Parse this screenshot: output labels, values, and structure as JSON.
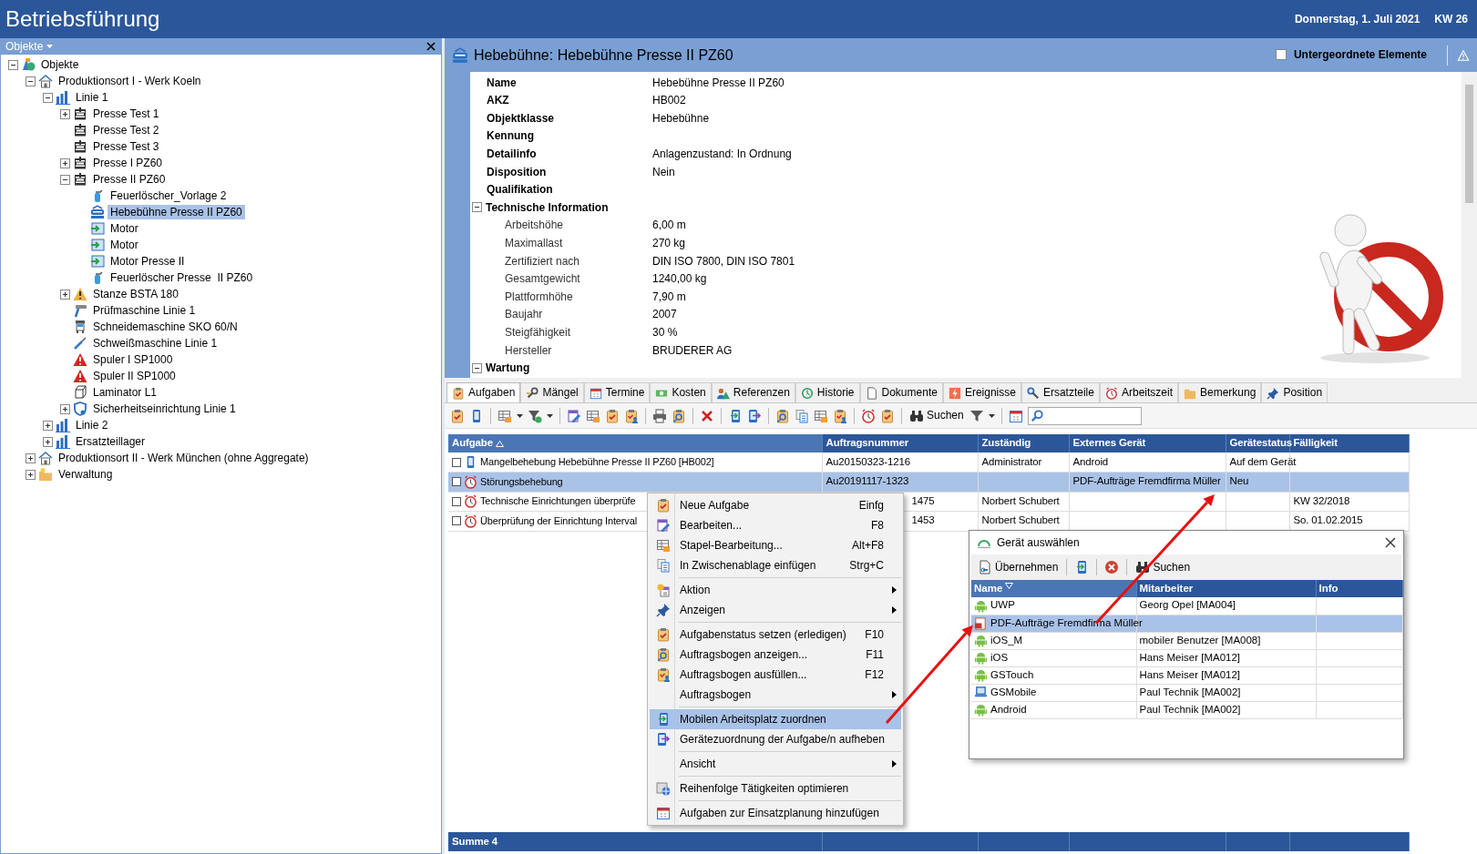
{
  "app": {
    "title": "Betriebsführung",
    "date": "Donnerstag, 1. Juli 2021",
    "week": "KW 26"
  },
  "objects_panel": {
    "title": "Objekte",
    "tree": [
      {
        "label": "Objekte",
        "kind": "root",
        "expanded": true,
        "selected": false,
        "children": [
          {
            "label": "Produktionsort I - Werk Koeln",
            "kind": "site",
            "expanded": true,
            "selected": false,
            "children": [
              {
                "label": "Linie 1",
                "kind": "line",
                "expanded": true,
                "selected": false,
                "children": [
                  {
                    "label": "Presse Test 1",
                    "kind": "press",
                    "expanded": false,
                    "selected": false
                  },
                  {
                    "label": "Presse Test 2",
                    "kind": "press",
                    "selected": false
                  },
                  {
                    "label": "Presse Test 3",
                    "kind": "press",
                    "selected": false
                  },
                  {
                    "label": "Presse I PZ60",
                    "kind": "press",
                    "expanded": false,
                    "selected": false
                  },
                  {
                    "label": "Presse II PZ60",
                    "kind": "press",
                    "expanded": true,
                    "selected": false,
                    "children": [
                      {
                        "label": "Feuerlöscher_Vorlage 2",
                        "kind": "extinguisher",
                        "selected": false
                      },
                      {
                        "label": "Hebebühne Presse II PZ60",
                        "kind": "lift",
                        "selected": true
                      },
                      {
                        "label": "Motor",
                        "kind": "motor",
                        "selected": false
                      },
                      {
                        "label": "Motor",
                        "kind": "motor",
                        "selected": false
                      },
                      {
                        "label": "Motor Presse II",
                        "kind": "motor",
                        "selected": false
                      },
                      {
                        "label": "Feuerlöscher Presse  II PZ60",
                        "kind": "extinguisher",
                        "selected": false
                      }
                    ]
                  },
                  {
                    "label": "Stanze BSTA 180",
                    "kind": "warning",
                    "expanded": false,
                    "selected": false
                  },
                  {
                    "label": "Prüfmaschine Linie 1",
                    "kind": "tester",
                    "selected": false
                  },
                  {
                    "label": "Schneidemaschine SKO 60/N",
                    "kind": "cutter",
                    "selected": false
                  },
                  {
                    "label": "Schweißmaschine Linie 1",
                    "kind": "welder",
                    "selected": false
                  },
                  {
                    "label": "Spuler I SP1000",
                    "kind": "alert",
                    "selected": false
                  },
                  {
                    "label": "Spuler II SP1000",
                    "kind": "alert",
                    "selected": false
                  },
                  {
                    "label": "Laminator L1",
                    "kind": "laminator",
                    "selected": false
                  },
                  {
                    "label": "Sicherheitseinrichtung Linie 1",
                    "kind": "shield",
                    "expanded": false,
                    "selected": false
                  }
                ]
              },
              {
                "label": "Linie 2",
                "kind": "line",
                "expanded": false,
                "selected": false
              },
              {
                "label": "Ersatzteillager",
                "kind": "line",
                "expanded": false,
                "selected": false
              }
            ]
          },
          {
            "label": "Produktionsort II - Werk München (ohne Aggregate)",
            "kind": "site",
            "expanded": false,
            "selected": false
          },
          {
            "label": "Verwaltung",
            "kind": "folder",
            "expanded": false,
            "selected": false
          }
        ]
      }
    ]
  },
  "detail": {
    "title": "Hebebühne: Hebebühne Presse II PZ60",
    "subordinate": {
      "label": "Untergeordnete Elemente",
      "checked": false
    },
    "properties": [
      {
        "label": "Name",
        "value": "Hebebühne Presse II PZ60"
      },
      {
        "label": "AKZ",
        "value": "HB002"
      },
      {
        "label": "Objektklasse",
        "value": "Hebebühne"
      },
      {
        "label": "Kennung"
      },
      {
        "label": "Detailinfo",
        "value": "Anlagenzustand: In Ordnung"
      },
      {
        "label": "Disposition",
        "value": "Nein"
      },
      {
        "label": "Qualifikation"
      }
    ],
    "sections": [
      {
        "title": "Technische Information",
        "expanded": true,
        "items": [
          {
            "label": "Arbeitshöhe",
            "value": "6,00 m"
          },
          {
            "label": "Maximallast",
            "value": "270 kg"
          },
          {
            "label": "Zertifiziert nach",
            "value": "DIN ISO 7800, DIN ISO 7801"
          },
          {
            "label": "Gesamtgewicht",
            "value": "1240,00 kg"
          },
          {
            "label": "Plattformhöhe",
            "value": "7,90 m"
          },
          {
            "label": "Baujahr",
            "value": "2007"
          },
          {
            "label": "Steigfähigkeit",
            "value": "30 %"
          },
          {
            "label": "Hersteller",
            "value": "BRUDERER AG"
          }
        ]
      },
      {
        "title": "Wartung",
        "expanded": true
      }
    ]
  },
  "tabs": [
    {
      "label": "Aufgaben",
      "kind": "clipboard",
      "selected": true
    },
    {
      "label": "Mängel",
      "kind": "wrench",
      "selected": false
    },
    {
      "label": "Termine",
      "kind": "calendar",
      "selected": false
    },
    {
      "label": "Kosten",
      "kind": "money",
      "selected": false
    },
    {
      "label": "Referenzen",
      "kind": "people",
      "selected": false
    },
    {
      "label": "Historie",
      "kind": "history",
      "selected": false
    },
    {
      "label": "Dokumente",
      "kind": "document",
      "selected": false
    },
    {
      "label": "Ereignisse",
      "kind": "flash",
      "selected": false
    },
    {
      "label": "Ersatzteile",
      "kind": "parts",
      "selected": false
    },
    {
      "label": "Arbeitszeit",
      "kind": "alarm",
      "selected": false
    },
    {
      "label": "Bemerkung",
      "kind": "note",
      "selected": false
    },
    {
      "label": "Position",
      "kind": "pin",
      "selected": false
    }
  ],
  "toolbar": {
    "search_label": "Suchen"
  },
  "table": {
    "columns": [
      {
        "label": "Aufgabe",
        "sorted": true,
        "sort_descending": false
      },
      {
        "label": "Auftragsnummer",
        "sorted": false
      },
      {
        "label": "Zuständig",
        "sorted": false
      },
      {
        "label": "Externes Gerät",
        "sorted": false
      },
      {
        "label": "Gerätestatus",
        "sorted": false
      },
      {
        "label": "Fälligkeit",
        "sorted": false
      }
    ],
    "rows": [
      {
        "kind": "phone",
        "checked": false,
        "selected": false,
        "covered": false,
        "task": "Mangelbehebung Hebebühne Presse II PZ60 [HB002]",
        "order_no": "Au20150323-1216",
        "assignee": "Administrator",
        "device": "Android",
        "device_status": "Auf dem Gerät"
      },
      {
        "kind": "alarm",
        "checked": false,
        "selected": true,
        "covered": false,
        "task": "Störungsbehebung",
        "order_no": "Au20191117-1323",
        "device": "PDF-Aufträge Fremdfirma Müller",
        "device_status": "Neu"
      },
      {
        "kind": "alarm",
        "checked": false,
        "selected": false,
        "covered": true,
        "task": "Technische Einrichtungen überprüfe",
        "order_no": "1475",
        "assignee": "Norbert Schubert",
        "due": "KW 32/2018"
      },
      {
        "kind": "alarm",
        "checked": false,
        "selected": false,
        "covered": true,
        "task": "Überprüfung der Einrichtung Interval",
        "order_no": "1453",
        "assignee": "Norbert Schubert",
        "due": "So. 01.02.2015"
      }
    ],
    "footer": "Summe 4"
  },
  "context_menu": {
    "groups": [
      [
        {
          "label": "Neue Aufgabe",
          "shortcut": "Einfg",
          "kind": "clipboard",
          "submenu": false,
          "highlighted": false
        },
        {
          "label": "Bearbeiten...",
          "shortcut": "F8",
          "kind": "edit",
          "submenu": false,
          "highlighted": false
        },
        {
          "label": "Stapel-Bearbeitung...",
          "shortcut": "Alt+F8",
          "kind": "grid",
          "submenu": false,
          "highlighted": false
        },
        {
          "label": "In Zwischenablage einfügen",
          "shortcut": "Strg+C",
          "kind": "copy",
          "submenu": false,
          "highlighted": false
        }
      ],
      [
        {
          "label": "Aktion",
          "kind": "star",
          "submenu": true,
          "highlighted": false
        },
        {
          "label": "Anzeigen",
          "kind": "pin",
          "submenu": true,
          "highlighted": false
        }
      ],
      [
        {
          "label": "Aufgabenstatus setzen (erledigen)",
          "shortcut": "F10",
          "kind": "clipboard",
          "submenu": false,
          "highlighted": false
        },
        {
          "label": "Auftragsbogen anzeigen...",
          "shortcut": "F11",
          "kind": "clipsearch",
          "submenu": false,
          "highlighted": false
        },
        {
          "label": "Auftragsbogen ausfüllen...",
          "shortcut": "F12",
          "kind": "clipuser",
          "submenu": false,
          "highlighted": false
        },
        {
          "label": "Auftragsbogen",
          "kind": "none",
          "submenu": true,
          "highlighted": false
        }
      ],
      [
        {
          "label": "Mobilen Arbeitsplatz zuordnen",
          "kind": "phonein",
          "submenu": false,
          "highlighted": true
        },
        {
          "label": "Gerätezuordnung der Aufgabe/n aufheben",
          "kind": "phoneout",
          "submenu": false,
          "highlighted": false
        }
      ],
      [
        {
          "label": "Ansicht",
          "kind": "none",
          "submenu": true,
          "highlighted": false
        }
      ],
      [
        {
          "label": "Reihenfolge Tätigkeiten optimieren",
          "kind": "map",
          "submenu": false,
          "highlighted": false
        }
      ],
      [
        {
          "label": "Aufgaben zur Einsatzplanung hinzufügen",
          "kind": "calendar",
          "submenu": false,
          "highlighted": false
        }
      ]
    ]
  },
  "dialog": {
    "title": "Gerät auswählen",
    "toolbar": [
      {
        "label": "Übernehmen",
        "kind": "linkdoc"
      },
      {
        "kind": "phonein"
      },
      {
        "kind": "cancel"
      },
      {
        "label": "Suchen",
        "kind": "binoculars"
      }
    ],
    "columns": [
      {
        "label": "Name",
        "sorted": true,
        "sort_descending": true
      },
      {
        "label": "Mitarbeiter",
        "sorted": false
      },
      {
        "label": "Info",
        "sorted": false
      }
    ],
    "rows": [
      {
        "kind": "android",
        "name": "UWP",
        "employee": "Georg Opel [MA004]",
        "selected": false
      },
      {
        "kind": "pdf",
        "name": "PDF-Aufträge Fremdfirma Müller",
        "selected": true
      },
      {
        "kind": "android",
        "name": "iOS_M",
        "employee": "mobiler Benutzer [MA008]",
        "selected": false
      },
      {
        "kind": "android",
        "name": "iOS",
        "employee": "Hans Meiser [MA012]",
        "selected": false
      },
      {
        "kind": "android",
        "name": "GSTouch",
        "employee": "Hans Meiser [MA012]",
        "selected": false
      },
      {
        "kind": "laptop",
        "name": "GSMobile",
        "employee": "Paul Technik [MA002]",
        "selected": false
      },
      {
        "kind": "android",
        "name": "Android",
        "employee": "Paul Technik [MA002]",
        "selected": false
      }
    ]
  }
}
